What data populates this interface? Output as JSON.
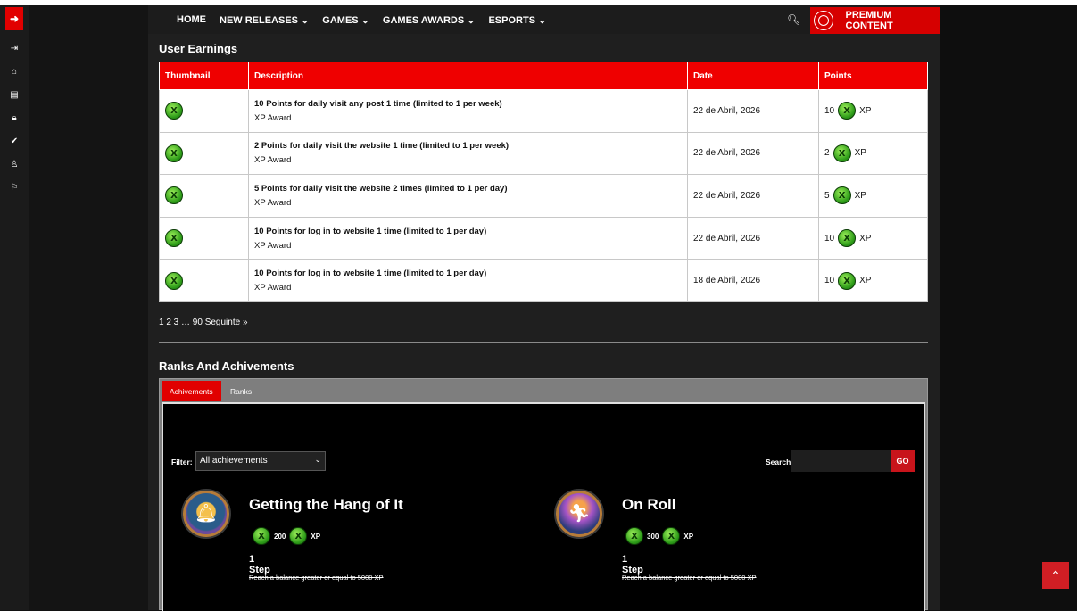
{
  "sidebar": {
    "exit_icon": "arrow-enter-icon",
    "icons": [
      "logout-icon",
      "home-icon",
      "document-icon",
      "lock-icon",
      "check-icon",
      "user-icon",
      "bookmark-icon"
    ]
  },
  "nav": {
    "items": [
      "HOME",
      "NEW RELEASES ⌄",
      "GAMES ⌄",
      "GAMES AWARDS ⌄",
      "ESPORTS ⌄"
    ],
    "premium_label": "PREMIUM CONTENT"
  },
  "earnings": {
    "title": "User Earnings",
    "headers": {
      "thumbnail": "Thumbnail",
      "description": "Description",
      "date": "Date",
      "points": "Points"
    },
    "rows": [
      {
        "desc": "10 Points for daily visit any post 1 time (limited to 1 per week)",
        "type": "XP Award",
        "date": "22 de Abril, 2026",
        "points": "10",
        "unit": "XP"
      },
      {
        "desc": "2 Points for daily visit the website 1 time (limited to 1 per week)",
        "type": "XP Award",
        "date": "22 de Abril, 2026",
        "points": "2",
        "unit": "XP"
      },
      {
        "desc": "5 Points for daily visit the website 2 times (limited to 1 per day)",
        "type": "XP Award",
        "date": "22 de Abril, 2026",
        "points": "5",
        "unit": "XP"
      },
      {
        "desc": "10 Points for log in to website 1 time (limited to 1 per day)",
        "type": "XP Award",
        "date": "22 de Abril, 2026",
        "points": "10",
        "unit": "XP"
      },
      {
        "desc": "10 Points for log in to website 1 time (limited to 1 per day)",
        "type": "XP Award",
        "date": "18 de Abril, 2026",
        "points": "10",
        "unit": "XP"
      }
    ],
    "pagination": "1 2 3 … 90 Seguinte »"
  },
  "ranks": {
    "title": "Ranks And Achivements",
    "tabs": {
      "achievements": "Achivements",
      "ranks": "Ranks"
    },
    "filter_label": "Filter:",
    "filter_value": "All achievements",
    "search_label": "Search:",
    "go_label": "GO",
    "achievements": [
      {
        "title": "Getting the Hang of It",
        "points": "200",
        "unit": "XP",
        "step": "1 Step",
        "desc": "Reach a balance greater or equal to 5000 XP"
      },
      {
        "title": "On Roll",
        "points": "300",
        "unit": "XP",
        "step": "1 Step",
        "desc": "Reach a balance greater or equal to 5000 XP"
      }
    ]
  },
  "colors": {
    "accent": "#ef0000",
    "background": "#1f1f1f",
    "panel": "#000000"
  }
}
